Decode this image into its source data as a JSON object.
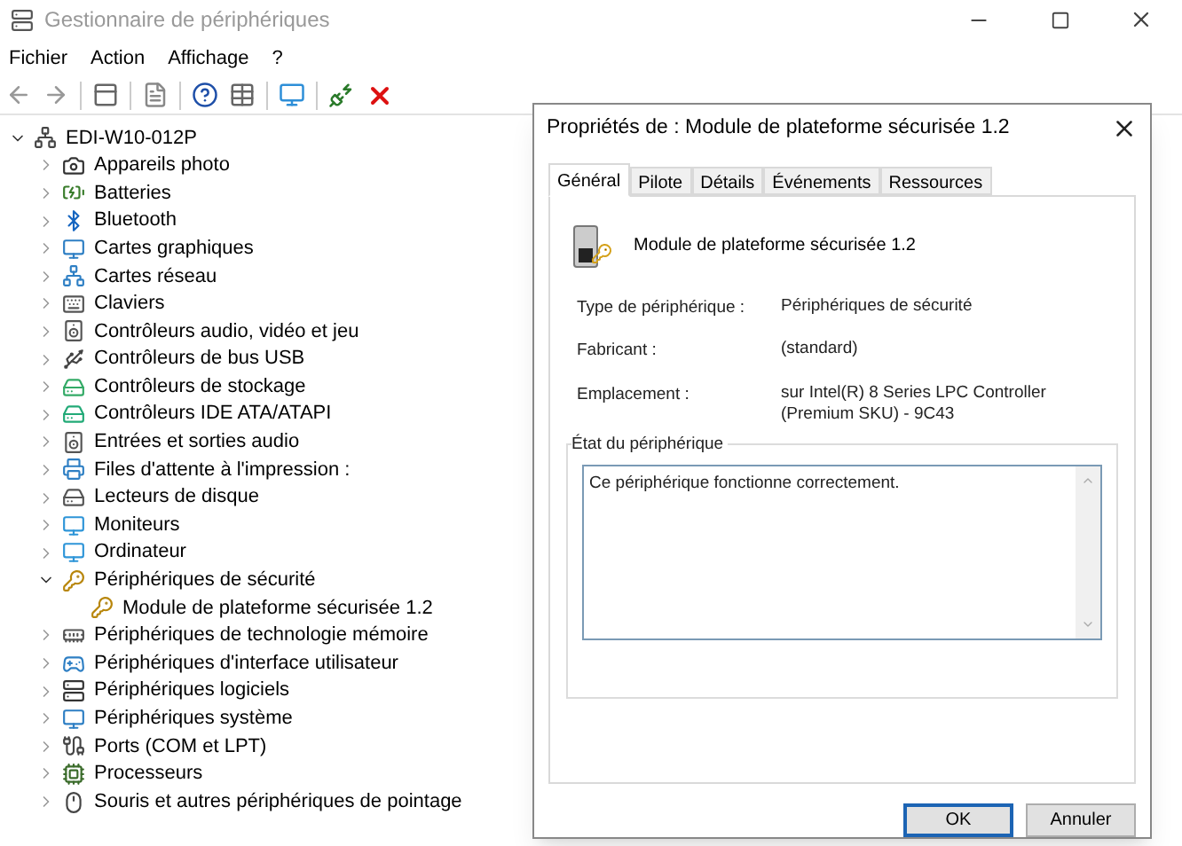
{
  "window": {
    "title": "Gestionnaire de périphériques"
  },
  "menu": [
    "Fichier",
    "Action",
    "Affichage",
    "?"
  ],
  "tree": {
    "label": "EDI-W10-012P",
    "expanded": true,
    "children": [
      {
        "label": "Appareils photo",
        "expanded": false
      },
      {
        "label": "Batteries",
        "expanded": false
      },
      {
        "label": "Bluetooth",
        "expanded": false
      },
      {
        "label": "Cartes graphiques",
        "expanded": false
      },
      {
        "label": "Cartes réseau",
        "expanded": false
      },
      {
        "label": "Claviers",
        "expanded": false
      },
      {
        "label": "Contrôleurs audio, vidéo et jeu",
        "expanded": false
      },
      {
        "label": "Contrôleurs de bus USB",
        "expanded": false
      },
      {
        "label": "Contrôleurs de stockage",
        "expanded": false
      },
      {
        "label": "Contrôleurs IDE ATA/ATAPI",
        "expanded": false
      },
      {
        "label": "Entrées et sorties audio",
        "expanded": false
      },
      {
        "label": "Files d'attente à l'impression :",
        "expanded": false
      },
      {
        "label": "Lecteurs de disque",
        "expanded": false
      },
      {
        "label": "Moniteurs",
        "expanded": false
      },
      {
        "label": "Ordinateur",
        "expanded": false
      },
      {
        "label": "Périphériques de sécurité",
        "expanded": true,
        "children": [
          {
            "label": "Module de plateforme sécurisée 1.2"
          }
        ]
      },
      {
        "label": "Périphériques de technologie mémoire",
        "expanded": false
      },
      {
        "label": "Périphériques d'interface utilisateur",
        "expanded": false
      },
      {
        "label": "Périphériques logiciels",
        "expanded": false
      },
      {
        "label": "Périphériques système",
        "expanded": false
      },
      {
        "label": "Ports (COM et LPT)",
        "expanded": false
      },
      {
        "label": "Processeurs",
        "expanded": false
      },
      {
        "label": "Souris et autres périphériques de pointage",
        "expanded": false
      }
    ]
  },
  "dialog": {
    "title": "Propriétés de : Module de plateforme sécurisée 1.2",
    "tabs": [
      {
        "label": "Général",
        "selected": true
      },
      {
        "label": "Pilote",
        "selected": false
      },
      {
        "label": "Détails",
        "selected": false
      },
      {
        "label": "Événements",
        "selected": false
      },
      {
        "label": "Ressources",
        "selected": false
      }
    ],
    "device_name": "Module de plateforme sécurisée 1.2",
    "properties": [
      {
        "label": "Type de périphérique :",
        "value": "Périphériques de sécurité"
      },
      {
        "label": "Fabricant :",
        "value": "(standard)"
      },
      {
        "label": "Emplacement :",
        "value": "sur Intel(R) 8 Series LPC Controller (Premium SKU) - 9C43"
      }
    ],
    "status_group": {
      "title": "État du périphérique",
      "text": "Ce périphérique fonctionne correctement."
    },
    "buttons": [
      {
        "label": "OK",
        "default": true
      },
      {
        "label": "Annuler",
        "default": false
      }
    ]
  }
}
